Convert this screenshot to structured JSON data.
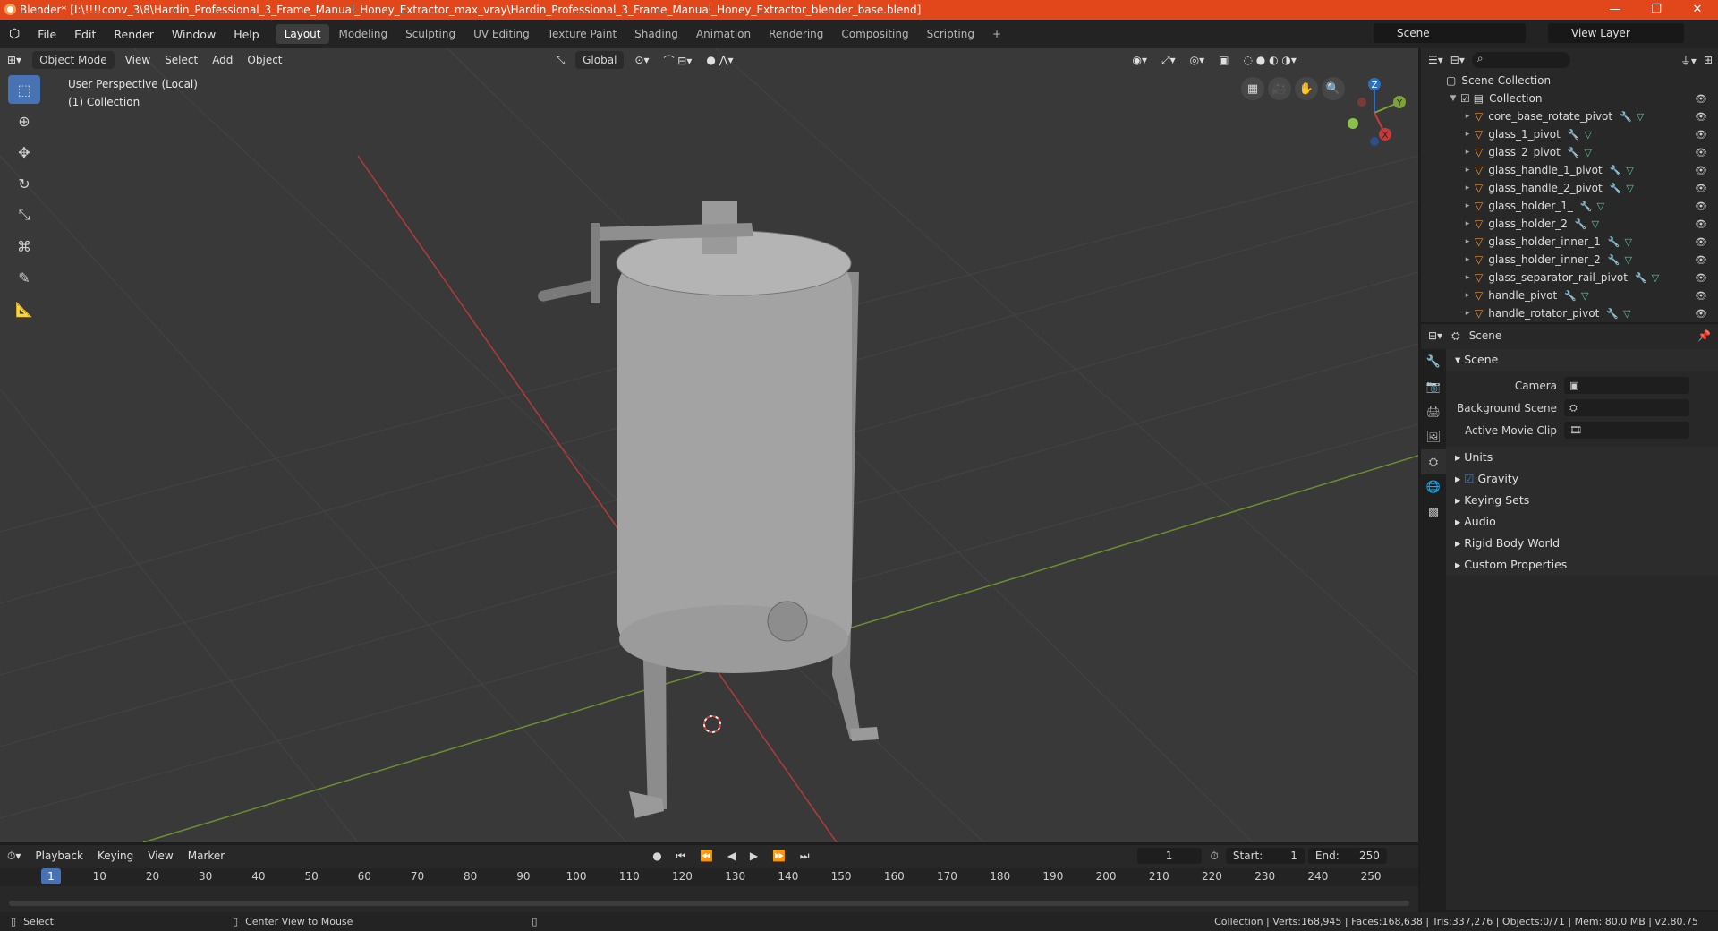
{
  "window": {
    "title": "Blender* [I:\\!!!!conv_3\\8\\Hardin_Professional_3_Frame_Manual_Honey_Extractor_max_vray\\Hardin_Professional_3_Frame_Manual_Honey_Extractor_blender_base.blend]",
    "controls": [
      "—",
      "❐",
      "✕"
    ]
  },
  "menu": [
    "File",
    "Edit",
    "Render",
    "Window",
    "Help"
  ],
  "workspaces": [
    "Layout",
    "Modeling",
    "Sculpting",
    "UV Editing",
    "Texture Paint",
    "Shading",
    "Animation",
    "Rendering",
    "Compositing",
    "Scripting"
  ],
  "active_workspace": "Layout",
  "scene_name": "Scene",
  "view_layer": "View Layer",
  "viewport": {
    "mode": "Object Mode",
    "menus": [
      "View",
      "Select",
      "Add",
      "Object"
    ],
    "orientation": "Global",
    "info_line1": "User Perspective (Local)",
    "info_line2": "(1) Collection",
    "gizmo": {
      "z": "Z",
      "y": "Y",
      "x": "X"
    }
  },
  "outliner": {
    "root": "Scene Collection",
    "collection": "Collection",
    "items": [
      "core_base_rotate_pivot",
      "glass_1_pivot",
      "glass_2_pivot",
      "glass_handle_1_pivot",
      "glass_handle_2_pivot",
      "glass_holder_1_",
      "glass_holder_2",
      "glass_holder_inner_1",
      "glass_holder_inner_2",
      "glass_separator_rail_pivot",
      "handle_pivot",
      "handle_rotator_pivot"
    ]
  },
  "properties": {
    "header": "Scene",
    "section": "Scene",
    "fields": {
      "camera": "Camera",
      "background_scene": "Background Scene",
      "active_movie_clip": "Active Movie Clip"
    },
    "panels": [
      "Units",
      "Gravity",
      "Keying Sets",
      "Audio",
      "Rigid Body World",
      "Custom Properties"
    ]
  },
  "timeline": {
    "menus": [
      "Playback",
      "Keying",
      "View",
      "Marker"
    ],
    "current_frame": "1",
    "start_label": "Start:",
    "start": "1",
    "end_label": "End:",
    "end": "250",
    "ticks": [
      "10",
      "20",
      "30",
      "40",
      "50",
      "60",
      "70",
      "80",
      "90",
      "100",
      "110",
      "120",
      "130",
      "140",
      "150",
      "160",
      "170",
      "180",
      "190",
      "200",
      "210",
      "220",
      "230",
      "240",
      "250"
    ]
  },
  "status": {
    "left": "Select",
    "middle": "Center View to Mouse",
    "right": "Collection | Verts:168,945 | Faces:168,638 | Tris:337,276 | Objects:0/71 | Mem: 80.0 MB | v2.80.75"
  },
  "colors": {
    "accent": "#4772b3",
    "titlebar": "#e2461b",
    "object_icon": "#e8913a"
  }
}
